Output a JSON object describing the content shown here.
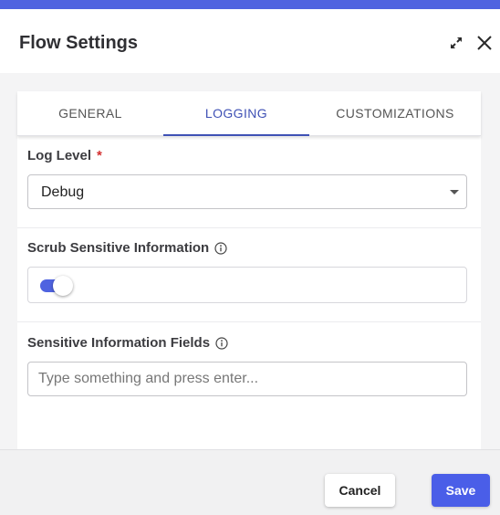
{
  "dialog": {
    "title": "Flow Settings",
    "icons": {
      "expand": "expand-icon",
      "close": "close-icon"
    },
    "accent_color": "#4f63e0"
  },
  "tabs": [
    {
      "label": "GENERAL",
      "active": false
    },
    {
      "label": "LOGGING",
      "active": true
    },
    {
      "label": "CUSTOMIZATIONS",
      "active": false
    }
  ],
  "log_level": {
    "label": "Log Level",
    "required_marker": "*",
    "value": "Debug"
  },
  "scrub": {
    "label": "Scrub Sensitive Information",
    "icon": "info-icon",
    "enabled": true
  },
  "sensitive_fields": {
    "label": "Sensitive Information Fields",
    "icon": "info-icon",
    "value": "",
    "placeholder": "Type something and press enter..."
  },
  "footer": {
    "cancel_label": "Cancel",
    "save_label": "Save"
  }
}
